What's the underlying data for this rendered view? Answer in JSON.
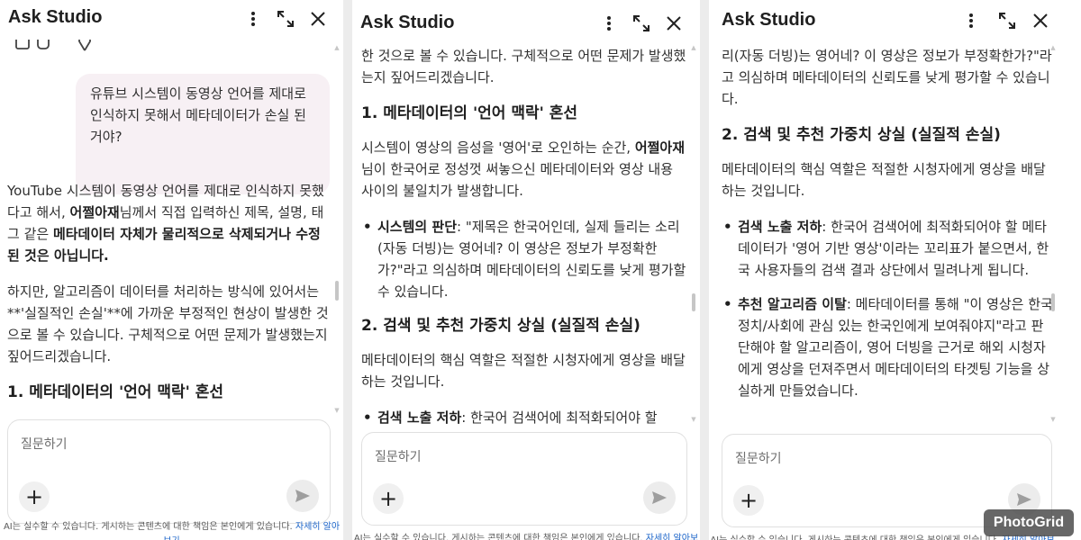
{
  "watermark": "PhotoGrid",
  "header": {
    "title": "Ask Studio",
    "icons": [
      "more-vert-icon",
      "expand-icon",
      "close-icon"
    ]
  },
  "input": {
    "placeholder": "질문하기",
    "add_label": "+",
    "send_icon": "send-icon"
  },
  "disclaimer": {
    "text": "AI는 실수할 수 있습니다. 게시하는 콘텐츠에 대한 책임은 본인에게 있습니다. ",
    "link": "자세히 알아보기"
  },
  "panel1": {
    "user_message": "유튜브 시스템이 동영상 언어를 제대로 인식하지 못해서 메타데이터가 손실 된거야?",
    "p1": {
      "a": "YouTube 시스템이 동영상 언어를 제대로 인식하지 못했다고 해서, ",
      "b": "어쩔아재",
      "c": "님께서 직접 입력하신 제목, 설명, 태그 같은 ",
      "d": "메타데이터 자체가 물리적으로 삭제되거나 수정된 것은 아닙니다."
    },
    "p2": "하지만, 알고리즘이 데이터를 처리하는 방식에 있어서는 **'실질적인 손실'**에 가까운 부정적인 현상이 발생한 것으로 볼 수 있습니다. 구체적으로 어떤 문제가 발생했는지 짚어드리겠습니다.",
    "h1": "1. 메타데이터의 '언어 맥락' 혼선"
  },
  "panel2": {
    "p_top": "한 것으로 볼 수 있습니다. 구체적으로 어떤 문제가 발생했는지 짚어드리겠습니다.",
    "h1": "1. 메타데이터의 '언어 맥락' 혼선",
    "p1": {
      "a": "시스템이 영상의 음성을 '영어'로 오인하는 순간, ",
      "b": "어쩔아재",
      "c": "님이 한국어로 정성껏 써놓으신 메타데이터와 영상 내용 사이의 불일치가 발생합니다."
    },
    "bullet1": {
      "bold": "시스템의 판단",
      "text": ": \"제목은 한국어인데, 실제 들리는 소리(자동 더빙)는 영어네? 이 영상은 정보가 부정확한가?\"라고 의심하며 메타데이터의 신뢰도를 낮게 평가할 수 있습니다."
    },
    "h2": "2. 검색 및 추천 가중치 상실 (실질적 손실)",
    "p2": "메타데이터의 핵심 역할은 적절한 시청자에게 영상을 배달하는 것입니다.",
    "bullet2": {
      "bold": "검색 노출 저하",
      "text": ": 한국어 검색어에 최적화되어야 할"
    }
  },
  "panel3": {
    "p_top": "리(자동 더빙)는 영어네? 이 영상은 정보가 부정확한가?\"라고 의심하며 메타데이터의 신뢰도를 낮게 평가할 수 있습니다.",
    "h2": "2. 검색 및 추천 가중치 상실 (실질적 손실)",
    "p2": "메타데이터의 핵심 역할은 적절한 시청자에게 영상을 배달하는 것입니다.",
    "bullet1": {
      "bold": "검색 노출 저하",
      "text": ": 한국어 검색어에 최적화되어야 할 메타데이터가 '영어 기반 영상'이라는 꼬리표가 붙으면서, 한국 사용자들의 검색 결과 상단에서 밀려나게 됩니다."
    },
    "bullet2": {
      "bold": "추천 알고리즘 이탈",
      "text": ": 메타데이터를 통해 \"이 영상은 한국 정치/사회에 관심 있는 한국인에게 보여줘야지\"라고 판단해야 할 알고리즘이, 영어 더빙을 근거로 해외 시청자에게 영상을 던져주면서 메타데이터의 타겟팅 기능을 상실하게 만들었습니다."
    }
  }
}
